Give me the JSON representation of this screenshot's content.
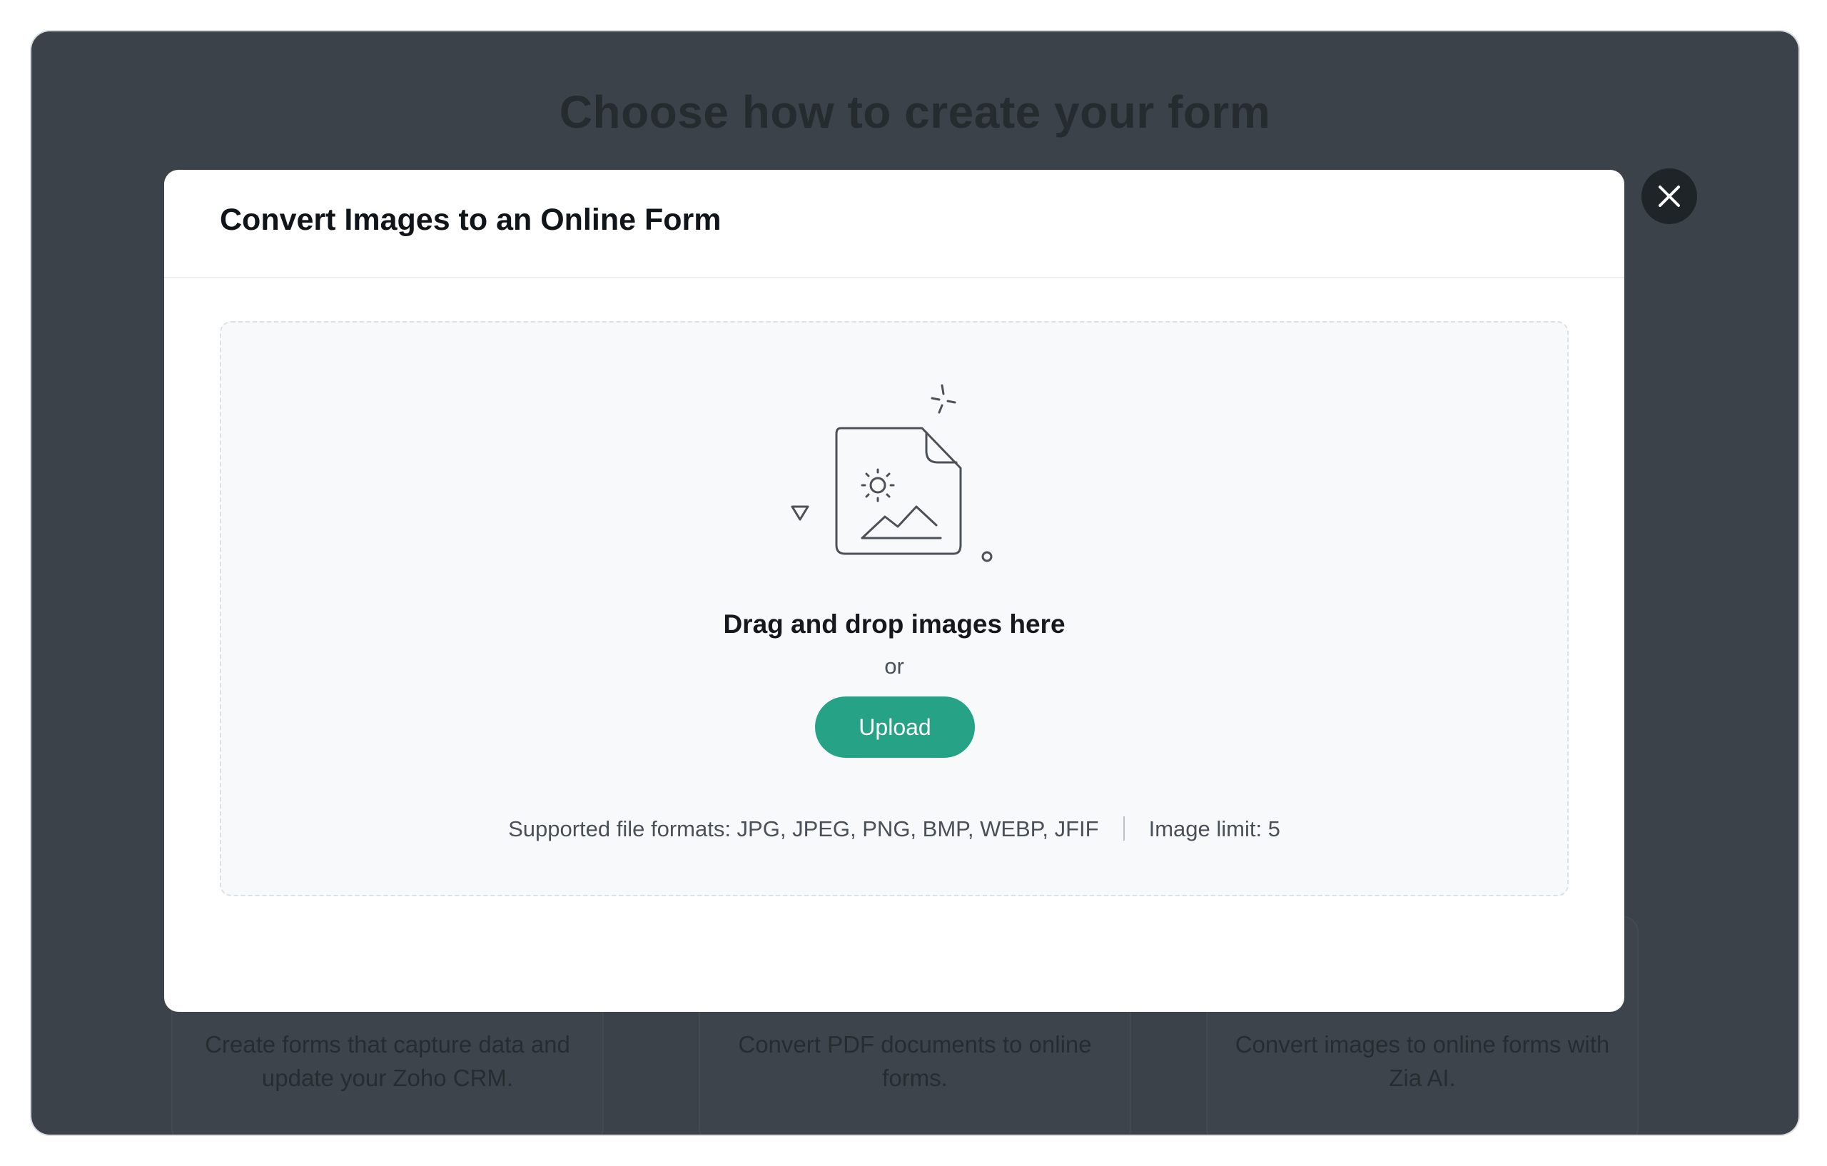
{
  "background": {
    "title": "Choose how to create your form",
    "cards": [
      {
        "description": "Create forms that capture data and update your Zoho CRM."
      },
      {
        "description": "Convert PDF documents to online forms."
      },
      {
        "description": "Convert images to online forms with Zia AI."
      }
    ]
  },
  "modal": {
    "title": "Convert Images to an Online Form",
    "dropzone": {
      "icon": "image-file-icon",
      "heading": "Drag and drop images here",
      "or_text": "or",
      "upload_label": "Upload",
      "supported_formats": "Supported file formats: JPG, JPEG, PNG, BMP, WEBP, JFIF",
      "image_limit": "Image limit: 5"
    },
    "close_icon": "close-icon"
  },
  "colors": {
    "overlay": "#3b4249",
    "accent": "#26a387",
    "close_button": "#1f2428"
  }
}
